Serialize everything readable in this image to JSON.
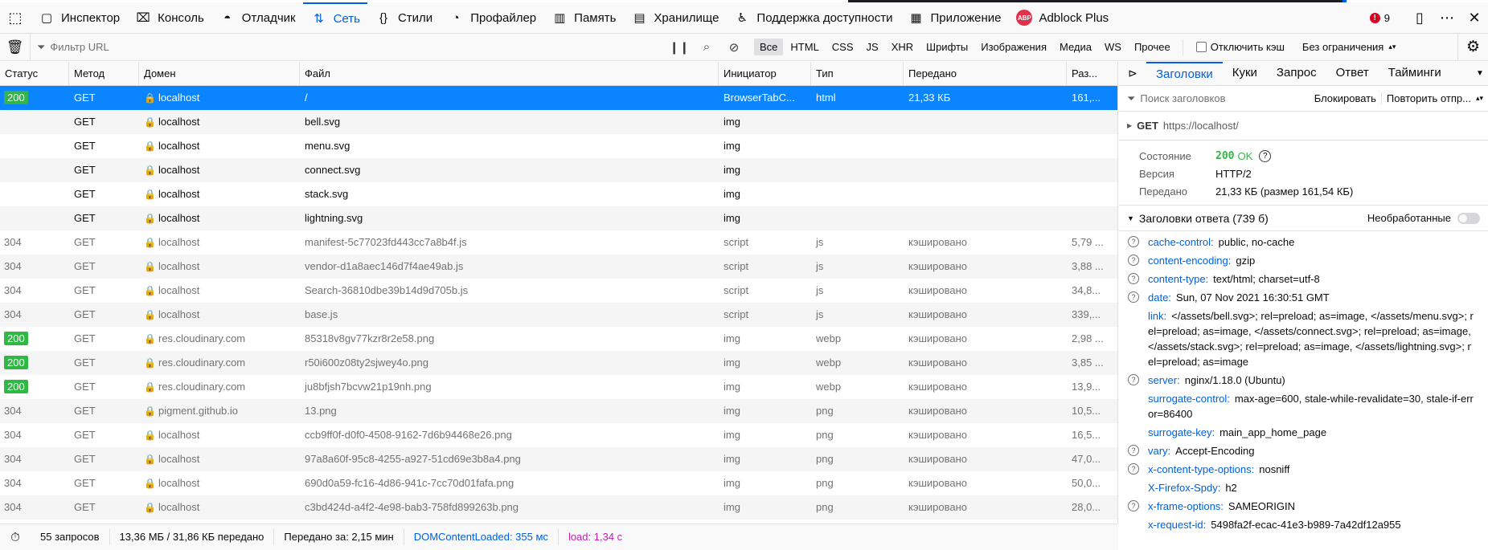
{
  "devtools": {
    "tabs": [
      {
        "id": "inspector",
        "label": "Инспектор",
        "icon": "inspector-icon",
        "glyph": "▢"
      },
      {
        "id": "console",
        "label": "Консоль",
        "icon": "console-icon",
        "glyph": "⌧"
      },
      {
        "id": "debugger",
        "label": "Отладчик",
        "icon": "debugger-icon",
        "glyph": "◓"
      },
      {
        "id": "network",
        "label": "Сеть",
        "icon": "network-icon",
        "glyph": "⇅",
        "active": true
      },
      {
        "id": "styles",
        "label": "Стили",
        "icon": "styles-icon",
        "glyph": "{}"
      },
      {
        "id": "profiler",
        "label": "Профайлер",
        "icon": "profiler-icon",
        "glyph": "◔"
      },
      {
        "id": "memory",
        "label": "Память",
        "icon": "memory-icon",
        "glyph": "▥"
      },
      {
        "id": "storage",
        "label": "Хранилище",
        "icon": "storage-icon",
        "glyph": "▤"
      },
      {
        "id": "accessibility",
        "label": "Поддержка доступности",
        "icon": "accessibility-icon",
        "glyph": "♿"
      },
      {
        "id": "application",
        "label": "Приложение",
        "icon": "application-icon",
        "glyph": "▦"
      },
      {
        "id": "adblock",
        "label": "Adblock Plus",
        "icon": "adblock-icon",
        "glyph": "ABP"
      }
    ],
    "error_count": "9",
    "accent": "#0060df"
  },
  "filterbar": {
    "placeholder": "Фильтр URL",
    "types": [
      {
        "label": "Все",
        "on": true
      },
      {
        "label": "HTML"
      },
      {
        "label": "CSS"
      },
      {
        "label": "JS"
      },
      {
        "label": "XHR"
      },
      {
        "label": "Шрифты"
      },
      {
        "label": "Изображения"
      },
      {
        "label": "Медиа"
      },
      {
        "label": "WS"
      },
      {
        "label": "Прочее"
      }
    ],
    "disable_cache": "Отключить кэш",
    "throttling": "Без ограничения"
  },
  "table": {
    "columns": [
      "Статус",
      "Метод",
      "Домен",
      "Файл",
      "Инициатор",
      "Тип",
      "Передано",
      "Раз..."
    ],
    "rows": [
      {
        "status": "200",
        "method": "GET",
        "domain": "localhost",
        "file": "/",
        "initiator": "BrowserTabC...",
        "type": "html",
        "transferred": "21,33 КБ",
        "size": "161,...",
        "selected": true,
        "badge": true
      },
      {
        "status": "",
        "method": "GET",
        "domain": "localhost",
        "file": "bell.svg",
        "initiator": "img",
        "type": "",
        "transferred": "",
        "size": ""
      },
      {
        "status": "",
        "method": "GET",
        "domain": "localhost",
        "file": "menu.svg",
        "initiator": "img",
        "type": "",
        "transferred": "",
        "size": ""
      },
      {
        "status": "",
        "method": "GET",
        "domain": "localhost",
        "file": "connect.svg",
        "initiator": "img",
        "type": "",
        "transferred": "",
        "size": ""
      },
      {
        "status": "",
        "method": "GET",
        "domain": "localhost",
        "file": "stack.svg",
        "initiator": "img",
        "type": "",
        "transferred": "",
        "size": ""
      },
      {
        "status": "",
        "method": "GET",
        "domain": "localhost",
        "file": "lightning.svg",
        "initiator": "img",
        "type": "",
        "transferred": "",
        "size": ""
      },
      {
        "status": "304",
        "method": "GET",
        "domain": "localhost",
        "file": "manifest-5c77023fd443cc7a8b4f.js",
        "initiator": "script",
        "type": "js",
        "transferred": "кэшировано",
        "size": "5,79 ...",
        "muted": true
      },
      {
        "status": "304",
        "method": "GET",
        "domain": "localhost",
        "file": "vendor-d1a8aec146d7f4ae49ab.js",
        "initiator": "script",
        "type": "js",
        "transferred": "кэшировано",
        "size": "3,88 ...",
        "muted": true
      },
      {
        "status": "304",
        "method": "GET",
        "domain": "localhost",
        "file": "Search-36810dbe39b14d9d705b.js",
        "initiator": "script",
        "type": "js",
        "transferred": "кэшировано",
        "size": "34,8...",
        "muted": true
      },
      {
        "status": "304",
        "method": "GET",
        "domain": "localhost",
        "file": "base.js",
        "initiator": "script",
        "type": "js",
        "transferred": "кэшировано",
        "size": "339,...",
        "muted": true
      },
      {
        "status": "200",
        "method": "GET",
        "domain": "res.cloudinary.com",
        "file": "85318v8gv77kzr8r2e58.png",
        "initiator": "img",
        "type": "webp",
        "transferred": "кэшировано",
        "size": "2,98 ...",
        "muted": true,
        "badge": true
      },
      {
        "status": "200",
        "method": "GET",
        "domain": "res.cloudinary.com",
        "file": "r50i600z08ty2sjwey4o.png",
        "initiator": "img",
        "type": "webp",
        "transferred": "кэшировано",
        "size": "3,85 ...",
        "muted": true,
        "badge": true
      },
      {
        "status": "200",
        "method": "GET",
        "domain": "res.cloudinary.com",
        "file": "ju8bfjsh7bcvw21p19nh.png",
        "initiator": "img",
        "type": "webp",
        "transferred": "кэшировано",
        "size": "13,9...",
        "muted": true,
        "badge": true
      },
      {
        "status": "304",
        "method": "GET",
        "domain": "pigment.github.io",
        "file": "13.png",
        "initiator": "img",
        "type": "png",
        "transferred": "кэшировано",
        "size": "10,5...",
        "muted": true
      },
      {
        "status": "304",
        "method": "GET",
        "domain": "localhost",
        "file": "ccb9ff0f-d0f0-4508-9162-7d6b94468e26.png",
        "initiator": "img",
        "type": "png",
        "transferred": "кэшировано",
        "size": "16,5...",
        "muted": true
      },
      {
        "status": "304",
        "method": "GET",
        "domain": "localhost",
        "file": "97a8a60f-95c8-4255-a927-51cd69e3b8a4.png",
        "initiator": "img",
        "type": "png",
        "transferred": "кэшировано",
        "size": "47,0...",
        "muted": true
      },
      {
        "status": "304",
        "method": "GET",
        "domain": "localhost",
        "file": "690d0a59-fc16-4d86-941c-7cc70d01fafa.png",
        "initiator": "img",
        "type": "png",
        "transferred": "кэшировано",
        "size": "50,0...",
        "muted": true
      },
      {
        "status": "304",
        "method": "GET",
        "domain": "localhost",
        "file": "c3bd424d-a4f2-4e98-bab3-758fd899263b.png",
        "initiator": "img",
        "type": "png",
        "transferred": "кэшировано",
        "size": "28,0...",
        "muted": true
      }
    ]
  },
  "statusbar": {
    "requests": "55 запросов",
    "transferred": "13,36 МБ / 31,86 КБ передано",
    "finish": "Передано за: 2,15 мин",
    "dcl": "DOMContentLoaded: 355 мс",
    "load": "load: 1,34 с"
  },
  "sidebar": {
    "tabs": [
      "Заголовки",
      "Куки",
      "Запрос",
      "Ответ",
      "Тайминги"
    ],
    "filter_placeholder": "Поиск заголовков",
    "block": "Блокировать",
    "resend": "Повторить отпр...",
    "request_method": "GET",
    "request_url": "https://localhost/",
    "summary": {
      "status_label": "Состояние",
      "status_code": "200",
      "status_text": "OK",
      "version_label": "Версия",
      "version": "HTTP/2",
      "transferred_label": "Передано",
      "transferred": "21,33 КБ (размер 161,54 КБ)"
    },
    "response_title": "Заголовки ответа (739 б)",
    "raw_label": "Необработанные",
    "headers": [
      {
        "name": "cache-control:",
        "value": "public, no-cache",
        "help": true
      },
      {
        "name": "content-encoding:",
        "value": "gzip",
        "help": true
      },
      {
        "name": "content-type:",
        "value": "text/html; charset=utf-8",
        "help": true
      },
      {
        "name": "date:",
        "value": "Sun, 07 Nov 2021 16:30:51 GMT",
        "help": true
      },
      {
        "name": "link:",
        "value": "</assets/bell.svg>; rel=preload; as=image, </assets/menu.svg>; rel=preload; as=image, </assets/connect.svg>; rel=preload; as=image, </assets/stack.svg>; rel=preload; as=image, </assets/lightning.svg>; rel=preload; as=image",
        "help": false
      },
      {
        "name": "server:",
        "value": "nginx/1.18.0 (Ubuntu)",
        "help": true
      },
      {
        "name": "surrogate-control:",
        "value": "max-age=600, stale-while-revalidate=30, stale-if-error=86400",
        "help": false
      },
      {
        "name": "surrogate-key:",
        "value": "main_app_home_page",
        "help": false
      },
      {
        "name": "vary:",
        "value": "Accept-Encoding",
        "help": true
      },
      {
        "name": "x-content-type-options:",
        "value": "nosniff",
        "help": true
      },
      {
        "name": "X-Firefox-Spdy:",
        "value": "h2",
        "help": false
      },
      {
        "name": "x-frame-options:",
        "value": "SAMEORIGIN",
        "help": true
      },
      {
        "name": "x-request-id:",
        "value": "5498fa2f-ecac-41e3-b989-7a42df12a955",
        "help": false
      }
    ]
  }
}
